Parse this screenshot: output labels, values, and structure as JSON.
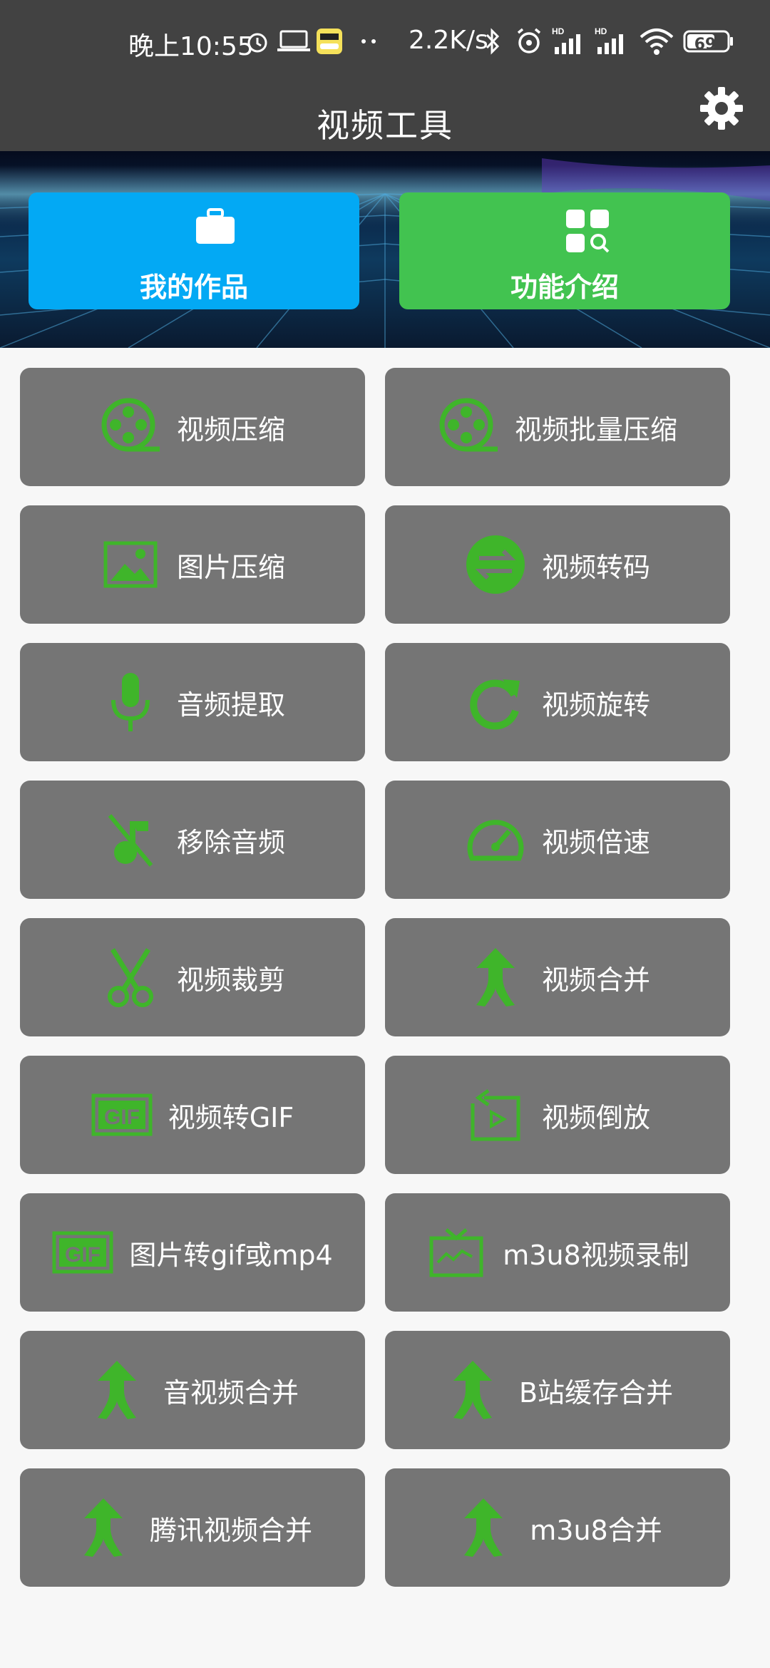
{
  "status_bar": {
    "time": "晚上10:55",
    "net_speed": "2.2K/s",
    "battery": "69"
  },
  "app_bar": {
    "title": "视频工具",
    "settings_icon": "gear-icon"
  },
  "banner": {
    "buttons": [
      {
        "label": "我的作品",
        "icon": "briefcase-icon",
        "color": "#03a9f4"
      },
      {
        "label": "功能介绍",
        "icon": "grid-search-icon",
        "color": "#42c350"
      }
    ]
  },
  "accent_color": "#3fb52a",
  "tile_color": "#757575",
  "tiles": [
    {
      "label": "视频压缩",
      "icon": "film-reel-icon"
    },
    {
      "label": "视频批量压缩",
      "icon": "film-reel-icon"
    },
    {
      "label": "图片压缩",
      "icon": "image-icon"
    },
    {
      "label": "视频转码",
      "icon": "swap-arrows-icon"
    },
    {
      "label": "音频提取",
      "icon": "microphone-icon"
    },
    {
      "label": "视频旋转",
      "icon": "rotate-icon"
    },
    {
      "label": "移除音频",
      "icon": "music-off-icon"
    },
    {
      "label": "视频倍速",
      "icon": "speedometer-icon"
    },
    {
      "label": "视频裁剪",
      "icon": "scissors-icon"
    },
    {
      "label": "视频合并",
      "icon": "merge-icon"
    },
    {
      "label": "视频转GIF",
      "icon": "gif-icon"
    },
    {
      "label": "视频倒放",
      "icon": "reverse-play-icon"
    },
    {
      "label": "图片转gif或mp4",
      "icon": "gif-icon"
    },
    {
      "label": "m3u8视频录制",
      "icon": "tv-icon"
    },
    {
      "label": "音视频合并",
      "icon": "merge-icon"
    },
    {
      "label": "B站缓存合并",
      "icon": "merge-icon"
    },
    {
      "label": "腾讯视频合并",
      "icon": "merge-icon"
    },
    {
      "label": "m3u8合并",
      "icon": "merge-icon"
    }
  ]
}
